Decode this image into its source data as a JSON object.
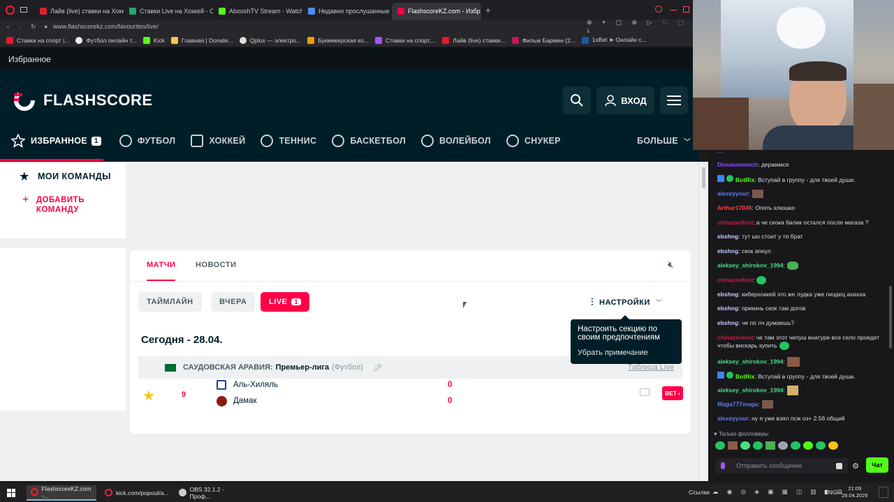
{
  "browser": {
    "tabs": [
      {
        "label": "Лайв (live) ставки на Хоккей",
        "color": "#e31c2d"
      },
      {
        "label": "Ставки Live на Хоккей - C",
        "color": "#1fa870"
      },
      {
        "label": "AbooshTV Stream - Watch",
        "color": "#53fc18"
      },
      {
        "label": "Недавно прослушанные",
        "color": "#4a8cff"
      },
      {
        "label": "FlashscoreKZ.com - Избр",
        "color": "#ff0046"
      }
    ],
    "url": "www.flashscorekz.com/favourites/live/",
    "bookmarks": [
      "Ставки на спорт |...",
      "Футбол онлайн т...",
      "Kick",
      "Главная | Donate...",
      "Qplus — электро...",
      "Букмекерская ко...",
      "Ставки на спорт,...",
      "Лайв (live) ставки...",
      "Фильм Бармен (2...",
      "1xBet ➤ Онлайн с..."
    ]
  },
  "flashscore": {
    "fav_title": "Избранное",
    "logo_text": "FLASHSCORE",
    "login_label": "ВХОД",
    "nav": [
      {
        "label": "ИЗБРАННОЕ",
        "badge": "1",
        "icon": "star-icon"
      },
      {
        "label": "ФУТБОЛ",
        "icon": "football-icon"
      },
      {
        "label": "ХОККЕЙ",
        "icon": "hockey-icon"
      },
      {
        "label": "ТЕННИС",
        "icon": "tennis-icon"
      },
      {
        "label": "БАСКЕТБОЛ",
        "icon": "basketball-icon"
      },
      {
        "label": "ВОЛЕЙБОЛ",
        "icon": "volleyball-icon"
      },
      {
        "label": "СНУКЕР",
        "icon": "snooker-icon"
      }
    ],
    "more_label": "БОЛЬШЕ",
    "sidebar": {
      "my_teams": "МОИ КОМАНДЫ",
      "add_team": "ДОБАВИТЬ КОМАНДУ"
    },
    "tabs": {
      "matches": "МАТЧИ",
      "news": "НОВОСТИ"
    },
    "filters": {
      "timeline": "ТАЙМЛАЙН",
      "yesterday": "ВЧЕРА",
      "live": "LIVE",
      "live_count": "1"
    },
    "settings_label": "НАСТРОЙКИ",
    "tooltip": {
      "text": "Настроить секцию по своим предпочтениям",
      "dismiss": "Убрать примечание"
    },
    "date_header": "Сегодня - 28.04.",
    "league": {
      "country": "САУДОВСКАЯ АРАВИЯ:",
      "name": "Премьер-лига",
      "sport": "(Футбол)",
      "standings": "Таблица Live"
    },
    "match": {
      "minute": "9",
      "home": "Аль-Хиляль",
      "away": "Дамак",
      "home_score": "0",
      "away_score": "0",
      "bet_label": "BET"
    }
  },
  "chat": {
    "messages": [
      {
        "user": "Dimannemech",
        "color": "#9147ff",
        "text": ": держимся"
      },
      {
        "user": "BotRix",
        "color": "#00ad03",
        "text": ": Вступай в группу - для твоей души."
      },
      {
        "user": "alexeyyour",
        "color": "#5c7cfa",
        "text": ":"
      },
      {
        "user": "Arthur17045",
        "color": "#ff4040",
        "text": ": Опять клюшко"
      },
      {
        "user": "chinazesfect",
        "color": "#d11a4a",
        "text": ": а че скока балик остался после магаза ?"
      },
      {
        "user": "ebshng",
        "color": "#c7c7ff",
        "text": ": тут шо стоит у тя брат"
      },
      {
        "user": "ebshng",
        "color": "#c7c7ff",
        "text": ": скок апнул"
      },
      {
        "user": "aleksey_shirokov_1994",
        "color": "#4ade80",
        "text": ":"
      },
      {
        "user": "chinazesfect",
        "color": "#d11a4a",
        "text": ":"
      },
      {
        "user": "ebshng",
        "color": "#c7c7ff",
        "text": ": киберхоккей это же лудка уже пиздец ахахха"
      },
      {
        "user": "ebshng",
        "color": "#c7c7ff",
        "text": ": прикинь скок там догов"
      },
      {
        "user": "ebshng",
        "color": "#c7c7ff",
        "text": ": че по лч думаешь?"
      },
      {
        "user": "chinazesfect",
        "color": "#d11a4a",
        "text": ": че там этот чепуш внатуре все село проедет чтобы вискарь купить"
      },
      {
        "user": "aleksey_shirokov_1994",
        "color": "#4ade80",
        "text": ":"
      },
      {
        "user": "BotRix",
        "color": "#00ad03",
        "text": ": Вступай в группу - для твоей души."
      },
      {
        "user": "aleksey_shirokov_1994",
        "color": "#4ade80",
        "text": ":"
      },
      {
        "user": "Maga777maga",
        "color": "#5c7cfa",
        "text": ":"
      },
      {
        "user": "alexeyyour",
        "color": "#5c7cfa",
        "text": ": ну я уже взял псж оз+ 2.56 общий"
      }
    ],
    "followers_only": "Только фолловеры",
    "input_placeholder": "Отправить сообщение",
    "send_label": "Чат"
  },
  "taskbar": {
    "items": [
      "FlashscoreKZ.com -...",
      "kick.com/popout/a...",
      "OBS 32.1.2 - Проф..."
    ],
    "links": "Ссылки",
    "lang": "ENG",
    "time": "21:09",
    "date": "28.04.2026"
  }
}
